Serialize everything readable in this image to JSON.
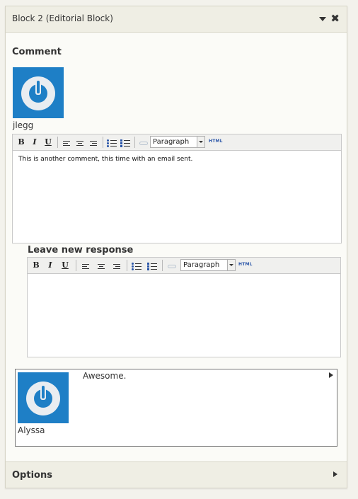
{
  "header": {
    "title": "Block 2 (Editorial Block)"
  },
  "comment": {
    "section_title": "Comment",
    "author": "jlegg",
    "body": "This is another comment, this time with an email sent."
  },
  "toolbar": {
    "bold": "B",
    "italic": "I",
    "underline": "U",
    "format_value": "Paragraph",
    "html_label": "HTML"
  },
  "response_editor": {
    "title": "Leave new response",
    "body": ""
  },
  "response": {
    "author": "Alyssa",
    "text": "Awesome."
  },
  "footer": {
    "title": "Options"
  },
  "colors": {
    "avatar": "#1e7fc6",
    "panel_header": "#efeee4"
  },
  "icons": [
    "power-icon",
    "chevron-down-icon",
    "close-icon",
    "chevron-right-icon",
    "link-icon"
  ]
}
